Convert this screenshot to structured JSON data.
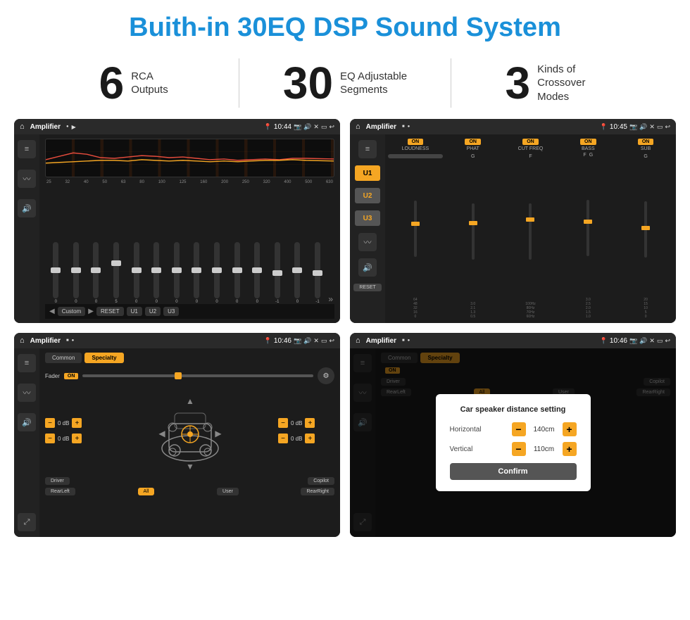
{
  "page": {
    "title": "Buith-in 30EQ DSP Sound System",
    "stats": [
      {
        "number": "6",
        "desc_line1": "RCA",
        "desc_line2": "Outputs"
      },
      {
        "number": "30",
        "desc_line1": "EQ Adjustable",
        "desc_line2": "Segments"
      },
      {
        "number": "3",
        "desc_line1": "Kinds of",
        "desc_line2": "Crossover Modes"
      }
    ]
  },
  "screen1": {
    "app": "Amplifier",
    "time": "10:44",
    "eq_labels": [
      "25",
      "32",
      "40",
      "50",
      "63",
      "80",
      "100",
      "125",
      "160",
      "200",
      "250",
      "320",
      "400",
      "500",
      "630"
    ],
    "eq_values": [
      "0",
      "0",
      "0",
      "5",
      "0",
      "0",
      "0",
      "0",
      "0",
      "0",
      "0",
      "-1",
      "0",
      "-1"
    ],
    "bottom_btns": [
      "Custom",
      "RESET",
      "U1",
      "U2",
      "U3"
    ]
  },
  "screen2": {
    "app": "Amplifier",
    "time": "10:45",
    "channels": [
      "LOUDNESS",
      "PHAT",
      "CUT FREQ",
      "BASS",
      "SUB"
    ],
    "u_buttons": [
      "U1",
      "U2",
      "U3"
    ],
    "reset_label": "RESET"
  },
  "screen3": {
    "app": "Amplifier",
    "time": "10:46",
    "tabs": [
      "Common",
      "Specialty"
    ],
    "fader_label": "Fader",
    "fader_on": "ON",
    "vol_rows": [
      {
        "value": "0 dB"
      },
      {
        "value": "0 dB"
      },
      {
        "value": "0 dB"
      },
      {
        "value": "0 dB"
      }
    ],
    "bottom_btns": [
      "Driver",
      "Copilot",
      "RearLeft",
      "All",
      "User",
      "RearRight"
    ]
  },
  "screen4": {
    "app": "Amplifier",
    "time": "10:46",
    "tabs": [
      "Common",
      "Specialty"
    ],
    "dialog": {
      "title": "Car speaker distance setting",
      "horizontal_label": "Horizontal",
      "horizontal_value": "140cm",
      "vertical_label": "Vertical",
      "vertical_value": "110cm",
      "confirm_label": "Confirm"
    },
    "bottom_btns": [
      "Driver",
      "Copilot",
      "RearLeft",
      "All",
      "User",
      "RearRight"
    ]
  }
}
